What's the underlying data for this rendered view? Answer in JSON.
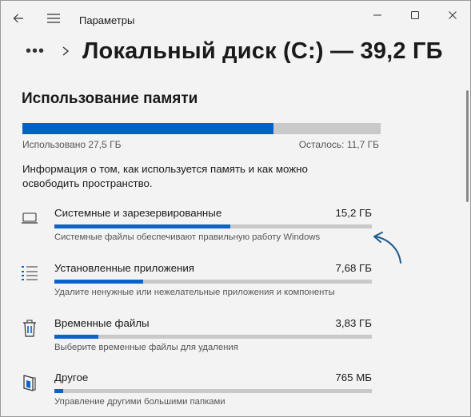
{
  "window": {
    "title": "Параметры"
  },
  "header": {
    "more_label": "•••",
    "page_title": "Локальный диск (C:) — 39,2 ГБ"
  },
  "usage": {
    "section_title": "Использование памяти",
    "used_label": "Использовано 27,5 ГБ",
    "free_label": "Осталось: 11,7 ГБ",
    "used_fraction": 0.701,
    "info_text": "Информация о том, как используется память и как можно освободить пространство."
  },
  "categories": [
    {
      "name": "Системные и зарезервированные",
      "size": "15,2 ГБ",
      "description": "Системные файлы обеспечивают правильную работу Windows",
      "fraction": 0.553,
      "icon": "laptop-icon"
    },
    {
      "name": "Установленные приложения",
      "size": "7,68 ГБ",
      "description": "Удалите ненужные или нежелательные приложения и компоненты",
      "fraction": 0.279,
      "icon": "apps-list-icon"
    },
    {
      "name": "Временные файлы",
      "size": "3,83 ГБ",
      "description": "Выберите временные файлы для удаления",
      "fraction": 0.139,
      "icon": "trash-icon"
    },
    {
      "name": "Другое",
      "size": "765 МБ",
      "description": "Управление другими большими папками",
      "fraction": 0.028,
      "icon": "folder-icon"
    }
  ],
  "colors": {
    "accent": "#0062c8",
    "bar_track": "#c9c9c9",
    "annotation_arrow": "#1e5a8c"
  }
}
